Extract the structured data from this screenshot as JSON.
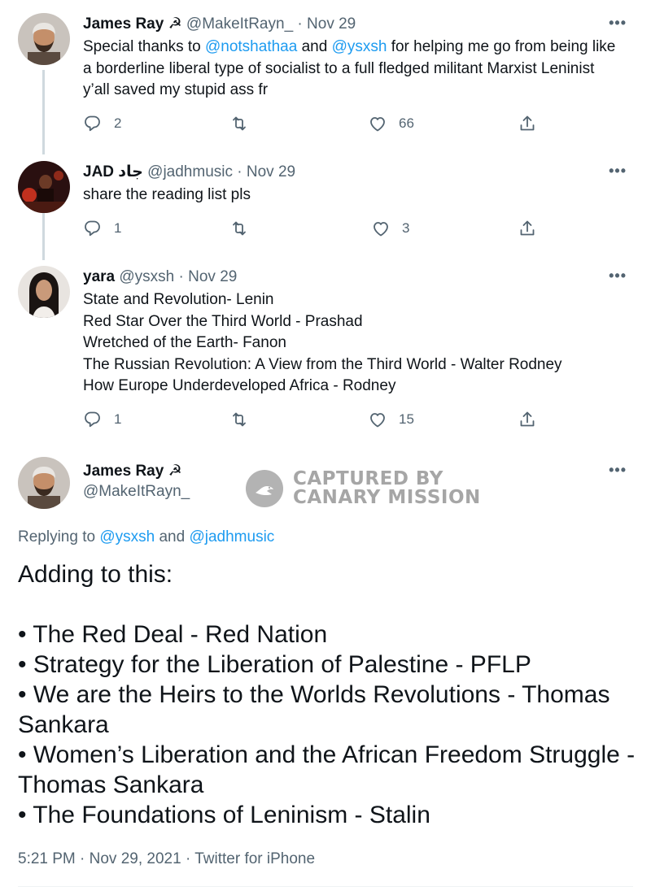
{
  "tweets": [
    {
      "name": "James Ray",
      "badge": "☭",
      "handle": "@MakeItRayn_",
      "date": "Nov 29",
      "text_parts": [
        "Special thanks to ",
        "@notshathaa",
        " and ",
        "@ysxsh",
        " for helping me go from being like a borderline liberal type of socialist to a full fledged militant Marxist Leninist y’all saved my stupid ass fr"
      ],
      "replies": "2",
      "likes": "66"
    },
    {
      "name": "JAD جاد",
      "handle": "@jadhmusic",
      "date": "Nov 29",
      "text": "share the reading list pls",
      "replies": "1",
      "likes": "3"
    },
    {
      "name": "yara",
      "handle": "@ysxsh",
      "date": "Nov 29",
      "lines": [
        "State and Revolution- Lenin",
        "Red Star Over the Third World - Prashad",
        "Wretched of the Earth- Fanon",
        "The Russian Revolution: A View from the Third World - Walter Rodney",
        "How Europe Underdeveloped Africa - Rodney"
      ],
      "replies": "1",
      "likes": "15"
    }
  ],
  "focused": {
    "name": "James Ray",
    "badge": "☭",
    "handle": "@MakeItRayn_",
    "replying_prefix": "Replying to ",
    "replying_to_1": "@ysxsh",
    "replying_and": " and ",
    "replying_to_2": "@jadhmusic",
    "lines": [
      "Adding to this:",
      "",
      "• The Red Deal - Red Nation",
      "• Strategy for the Liberation of Palestine - PFLP",
      "• We are the Heirs to the Worlds Revolutions - Thomas Sankara",
      "• Women’s Liberation and the African Freedom Struggle - Thomas Sankara",
      "• The Foundations of Leninism - Stalin"
    ],
    "timestamp": "5:21 PM · Nov 29, 2021 · Twitter for iPhone"
  },
  "watermark": {
    "line1": "CAPTURED BY",
    "line2": "CANARY MISSION"
  },
  "more_label": "•••",
  "dot_sep": "·",
  "icons": {
    "reply": "reply-icon",
    "retweet": "retweet-icon",
    "like": "like-icon",
    "share": "share-icon",
    "more": "more-icon"
  },
  "colors": {
    "link": "#1d9bf0",
    "secondary": "#536471",
    "primary_text": "#0f1419",
    "thread_line": "#cfd9de"
  }
}
